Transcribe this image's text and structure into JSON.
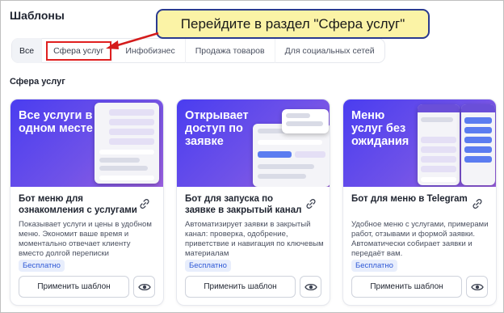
{
  "page": {
    "title": "Шаблоны"
  },
  "tabs": [
    {
      "label": "Все"
    },
    {
      "label": "Сфера услуг"
    },
    {
      "label": "Инфобизнес"
    },
    {
      "label": "Продажа товаров"
    },
    {
      "label": "Для социальных сетей"
    }
  ],
  "callout": {
    "text": "Перейдите в раздел \"Сфера услуг\""
  },
  "section": {
    "title": "Сфера услуг"
  },
  "cards": [
    {
      "banner": "Все услуги в одном месте",
      "title": "Бот меню для ознакомления с услугами",
      "description": "Показывает услуги и цены в удобном меню. Экономит ваше время и моментально отвечает клиенту вместо долгой переписки",
      "badge": "Бесплатно",
      "apply": "Применить шаблон"
    },
    {
      "banner": "Открывает доступ по заявке",
      "title": "Бот для запуска по заявке в закрытый канал",
      "description": "Автоматизирует заявки в закрытый канал: проверка, одобрение, приветствие и навигация по ключевым материалам",
      "badge": "Бесплатно",
      "apply": "Применить шаблон"
    },
    {
      "banner": "Меню услуг без ожидания",
      "title": "Бот для меню в Telegram",
      "description": "Удобное меню с услугами, примерами работ, отзывами и формой заявки. Автоматически собирает заявки и передаёт вам.",
      "badge": "Бесплатно",
      "apply": "Применить шаблон"
    }
  ],
  "colors": {
    "accent": "#2e58d6",
    "banner": "#5b46ea",
    "highlight": "#e02020",
    "callout_bg": "#fbf3a6",
    "callout_border": "#2a3a8f"
  }
}
